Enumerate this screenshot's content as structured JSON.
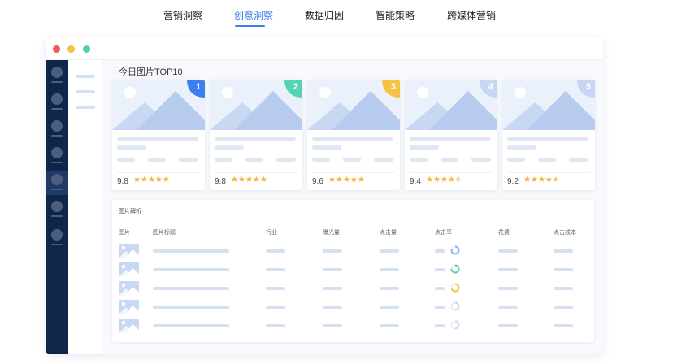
{
  "nav": {
    "tabs": [
      {
        "label": "营销洞察",
        "active": false
      },
      {
        "label": "创意洞察",
        "active": true
      },
      {
        "label": "数据归因",
        "active": false
      },
      {
        "label": "智能策略",
        "active": false
      },
      {
        "label": "跨媒体营销",
        "active": false
      }
    ]
  },
  "window": {
    "dots": [
      "#ef5b5b",
      "#f5c242",
      "#4ccfb1"
    ]
  },
  "top_images": {
    "title": "今日图片TOP10",
    "cards": [
      {
        "rank": "1",
        "score": "9.8",
        "stars": "★★★★★",
        "rating": 5,
        "badge_color": "#3d7ef0"
      },
      {
        "rank": "2",
        "score": "9.8",
        "stars": "★★★★★",
        "rating": 5,
        "badge_color": "#56d3b5"
      },
      {
        "rank": "3",
        "score": "9.6",
        "stars": "★★★★★",
        "rating": 5,
        "badge_color": "#f5c242"
      },
      {
        "rank": "4",
        "score": "9.4",
        "stars": "★★★★★",
        "rating": 4.5,
        "badge_color": "#c7d6f2"
      },
      {
        "rank": "5",
        "score": "9.2",
        "stars": "★★★★★",
        "rating": 4.5,
        "badge_color": "#c7d6f2"
      }
    ]
  },
  "analysis": {
    "title": "图片解析",
    "headers": [
      "图片",
      "图片标题",
      "行业",
      "曝光量",
      "点击量",
      "点击率",
      "花费",
      "点击成本"
    ],
    "rows": [
      {
        "ring_color": "#8fb4f2",
        "ring_fill": 0.8
      },
      {
        "ring_color": "#56d3b5",
        "ring_fill": 0.75
      },
      {
        "ring_color": "#f5c242",
        "ring_fill": 0.7
      },
      {
        "ring_color": "#c7d6f2",
        "ring_fill": 0.55
      },
      {
        "ring_color": "#c7d6f2",
        "ring_fill": 0.5
      }
    ]
  }
}
